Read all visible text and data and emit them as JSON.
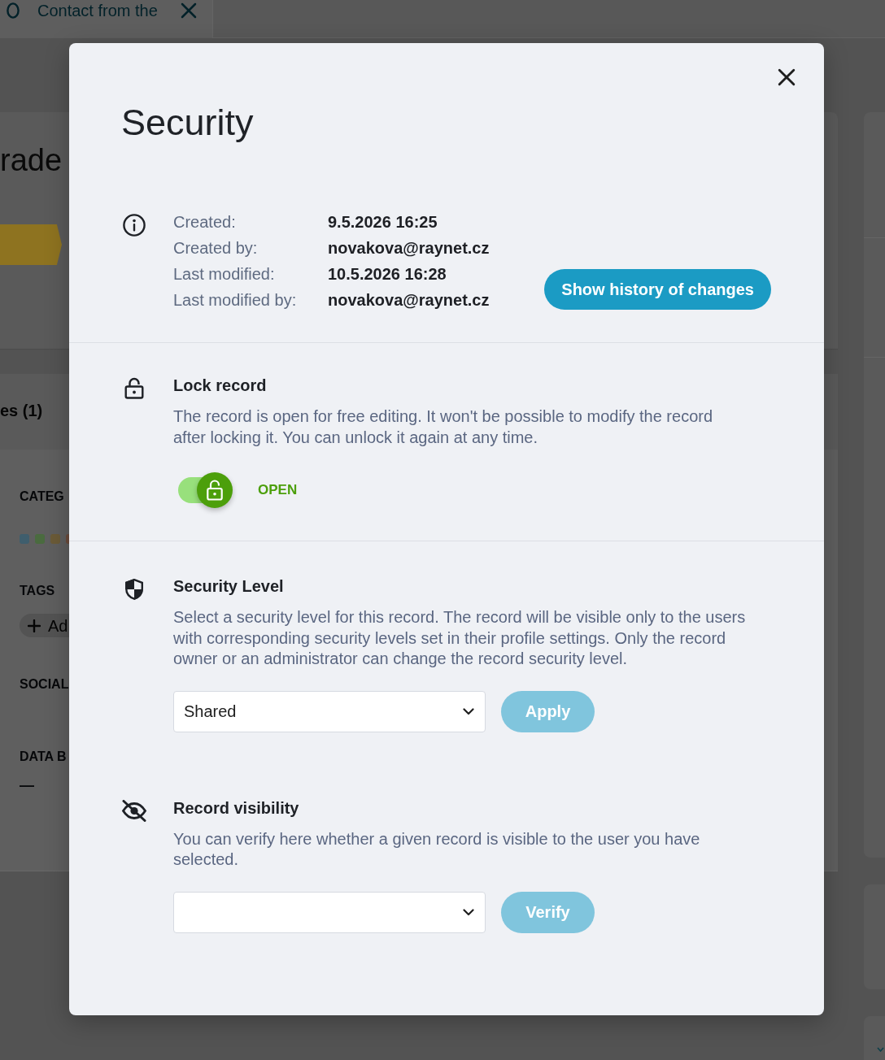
{
  "background": {
    "tab": {
      "label": "Contact from the"
    },
    "record_title": "rade",
    "panel_tab": "es (1)",
    "fields": [
      {
        "kind": "swatches",
        "label": "CATEG",
        "swatches": [
          {
            "color": "#3f5e6d"
          },
          {
            "color": "#4a6b3f"
          },
          {
            "color": "#6b5b38"
          },
          {
            "color": "#6b4b3b"
          }
        ]
      },
      {
        "kind": "add",
        "label": "TAGS",
        "button": "Ad"
      },
      {
        "kind": "plain",
        "label": "SOCIAL"
      },
      {
        "kind": "value",
        "label": "DATA B",
        "value": "—"
      }
    ]
  },
  "dialog": {
    "title": "Security",
    "sections": [
      {
        "kind": "info",
        "rows": [
          {
            "label": "Created:",
            "value": "9.5.2026 16:25"
          },
          {
            "label": "Created by:",
            "value": "novakova@raynet.cz"
          },
          {
            "label": "Last modified:",
            "value": "10.5.2026 16:28"
          },
          {
            "label": "Last modified by:",
            "value": "novakova@raynet.cz"
          }
        ],
        "button": "Show history of changes"
      },
      {
        "kind": "lock",
        "title": "Lock record",
        "description": "The record is open for free editing. It won't be possible to modify the record after locking it. You can unlock it again at any time.",
        "locked": false,
        "state_label": "OPEN"
      },
      {
        "kind": "level",
        "title": "Security Level",
        "description": "Select a security level for this record. The record will be visible only to the users with corresponding security levels set in their profile settings. Only the record owner or an administrator can change the record security level.",
        "select_value": "Shared",
        "button": {
          "label": "Apply",
          "disabled": true
        }
      },
      {
        "kind": "visibility",
        "title": "Record visibility",
        "description": "You can verify here whether a given record is visible to the user you have selected.",
        "button": {
          "label": "Verify",
          "disabled": true
        }
      }
    ]
  }
}
